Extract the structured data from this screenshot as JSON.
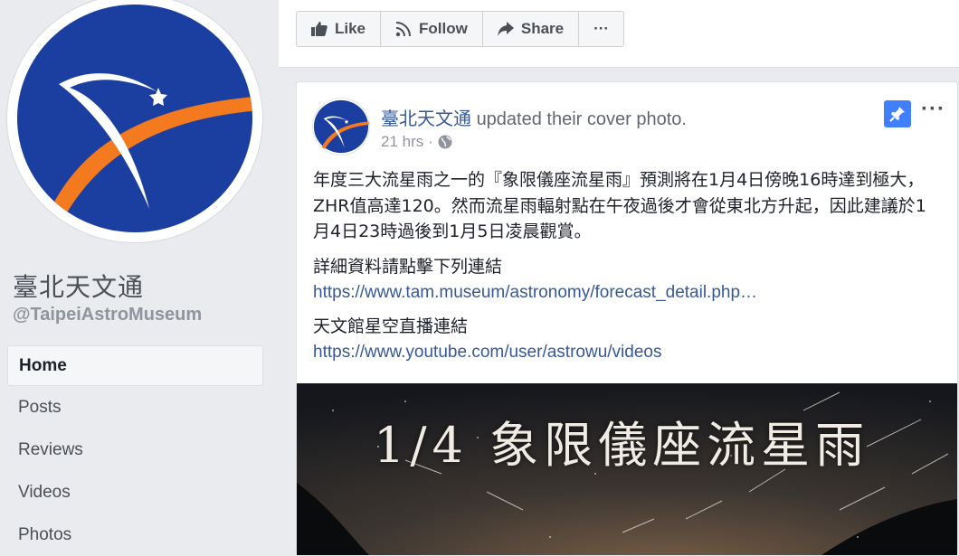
{
  "page": {
    "name": "臺北天文通",
    "handle": "@TaipeiAstroMuseum"
  },
  "nav": {
    "items": [
      "Home",
      "Posts",
      "Reviews",
      "Videos",
      "Photos"
    ]
  },
  "actions": {
    "like": "Like",
    "follow": "Follow",
    "share": "Share",
    "more": "···"
  },
  "post": {
    "author": "臺北天文通",
    "action": "updated their cover photo.",
    "time": "21 hrs",
    "more": "···",
    "paragraph1": "年度三大流星雨之一的『象限儀座流星雨』預測將在1月4日傍晚16時達到極大，ZHR值高達120。然而流星雨輻射點在午夜過後才會從東北方升起，因此建議於1月4日23時過後到1月5日凌晨觀賞。",
    "detail_label": "詳細資料請點擊下列連結",
    "detail_link": "https://www.tam.museum/astronomy/forecast_detail.php…",
    "live_label": "天文館星空直播連結",
    "live_link": "https://www.youtube.com/user/astrowu/videos",
    "image_title": "1/4  象限儀座流星雨"
  },
  "colors": {
    "brand_blue": "#1a3fa0",
    "brand_orange": "#f47a1f",
    "link": "#365899",
    "pin": "#4080ff"
  }
}
